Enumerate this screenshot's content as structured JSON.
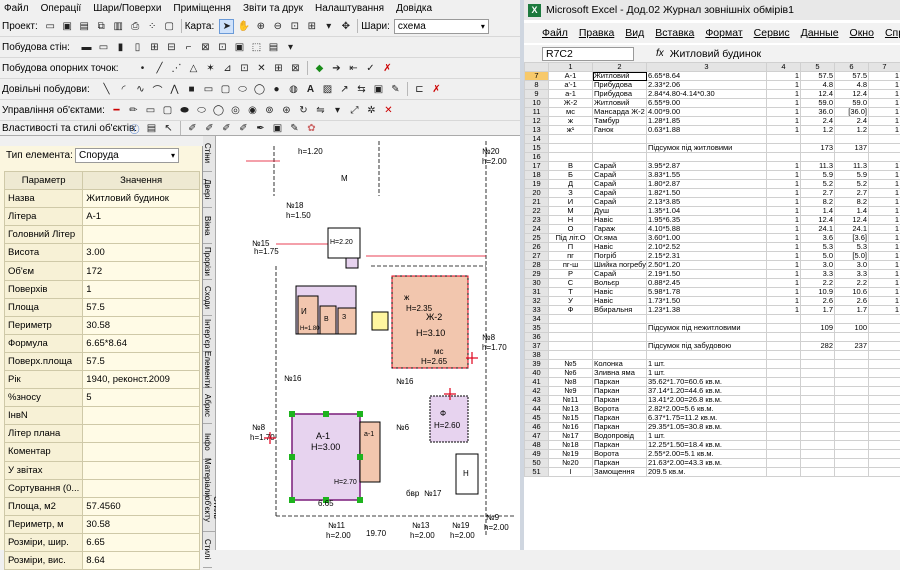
{
  "menu": [
    "Файл",
    "Операції",
    "Шари/Поверхи",
    "Приміщення",
    "Звіти та друк",
    "Налаштування",
    "Довідка"
  ],
  "toolbar": {
    "project_label": "Проект:",
    "map_label": "Карта:",
    "layers_label": "Шари:",
    "layers_value": "схема",
    "walls_label": "Побудова стін:",
    "points_label": "Побудова опорних точок:",
    "arbitrary_label": "Довільні побудови:",
    "objects_label": "Управління об'єктами:",
    "styles_label": "Властивості та стилі об'єктів:"
  },
  "properties": {
    "type_label": "Тип елемента:",
    "type_value": "Споруда",
    "col_param": "Параметр",
    "col_value": "Значення",
    "rows": [
      {
        "k": "Назва",
        "v": "Житловий будинок"
      },
      {
        "k": "Літера",
        "v": "А-1"
      },
      {
        "k": "Головний Літер",
        "v": ""
      },
      {
        "k": "Висота",
        "v": "3.00"
      },
      {
        "k": "Об'єм",
        "v": "172"
      },
      {
        "k": "Поверхів",
        "v": "1"
      },
      {
        "k": "Площа",
        "v": "57.5"
      },
      {
        "k": "Периметр",
        "v": "30.58"
      },
      {
        "k": "Формула",
        "v": "6.65*8.64"
      },
      {
        "k": "Поверх.площа",
        "v": "57.5"
      },
      {
        "k": "Рік",
        "v": "1940, реконст.2009"
      },
      {
        "k": "%зносу",
        "v": "5"
      },
      {
        "k": "ІнвN",
        "v": ""
      },
      {
        "k": "Літер плана",
        "v": ""
      },
      {
        "k": "Коментар",
        "v": ""
      },
      {
        "k": "У звітах",
        "v": ""
      },
      {
        "k": "Сортування (0...",
        "v": ""
      },
      {
        "k": "Площа, м2",
        "v": "57.4560"
      },
      {
        "k": "Периметр, м",
        "v": "30.58"
      },
      {
        "k": "Розміри, шир.",
        "v": "6.65"
      },
      {
        "k": "Розміри, вис.",
        "v": "8.64"
      }
    ]
  },
  "side_tabs": [
    "Стіни",
    "Двері",
    "Вікна",
    "Прорізи",
    "Сходи",
    "Інтер'єр",
    "Елементи",
    "Абрис",
    "Інфо",
    "Матеріали",
    "Стиль об'єкту",
    "Стилі"
  ],
  "plan": {
    "labels": [
      "A-1",
      "H=3.00",
      "Ж",
      "Ж-2",
      "мс",
      "З",
      "И",
      "В",
      "№15",
      "№18",
      "№20",
      "№16",
      "№16",
      "№8",
      "№9",
      "№8",
      "№6",
      "№11",
      "№13",
      "№19",
      "№17",
      "Ф",
      "Н",
      "пг-ш",
      "пг",
      "Б",
      "С",
      "а-1",
      "h=1.70",
      "h=1.75",
      "h=1.50",
      "h=2.00",
      "h=1.70",
      "h=2.00",
      "h=2.00",
      "h=2.00",
      "H=2.60",
      "H=3.10",
      "H=2.35",
      "H=2.65",
      "H=2.20",
      "H=1.80",
      "H=2.70",
      "6.65",
      "8.64",
      "19.70",
      "12.40",
      "9.75",
      "4.10",
      "бвр"
    ]
  },
  "excel": {
    "title": "Microsoft Excel - Дод.02 Журнал зовнішніх обмірів1",
    "menu": [
      "Файл",
      "Правка",
      "Вид",
      "Вставка",
      "Формат",
      "Сервис",
      "Данные",
      "Окно",
      "Спр"
    ],
    "namebox": "R7C2",
    "formula": "Житловий будинок",
    "col_headers": [
      "",
      "1",
      "2",
      "3",
      "4",
      "5",
      "6",
      "7"
    ],
    "rows": [
      [
        "7",
        "А-1",
        "Житловий",
        "6.65*8.64",
        "1",
        "57.5",
        "57.5",
        "1"
      ],
      [
        "8",
        "а'-1",
        "Прибудова",
        "2.33*2.06",
        "1",
        "4.8",
        "4.8",
        "1"
      ],
      [
        "9",
        "а-1",
        "Прибудова",
        "2.84*4.80-4.14*0.30",
        "1",
        "12.4",
        "12.4",
        "1"
      ],
      [
        "10",
        "Ж-2",
        "Житловий",
        "6.55*9.00",
        "1",
        "59.0",
        "59.0",
        "1"
      ],
      [
        "11",
        "мс",
        "Мансарда Ж-2",
        "4.00*9.00",
        "1",
        "36.0",
        "[36.0]",
        "1"
      ],
      [
        "12",
        "ж",
        "Тамбур",
        "1.28*1.85",
        "1",
        "2.4",
        "2.4",
        "1"
      ],
      [
        "13",
        "ж¹",
        "Ганок",
        "0.63*1.88",
        "1",
        "1.2",
        "1.2",
        "1"
      ],
      [
        "14",
        "",
        "",
        "",
        "",
        "",
        "",
        ""
      ],
      [
        "15",
        "",
        "",
        "Підсумок під житловими",
        "",
        "173",
        "137",
        ""
      ],
      [
        "16",
        "",
        "",
        "",
        "",
        "",
        "",
        ""
      ],
      [
        "17",
        "В",
        "Сарай",
        "3.95*2.87",
        "1",
        "11.3",
        "11.3",
        "1"
      ],
      [
        "18",
        "Б",
        "Сарай",
        "3.83*1.55",
        "1",
        "5.9",
        "5.9",
        "1"
      ],
      [
        "19",
        "Д",
        "Сарай",
        "1.80*2.87",
        "1",
        "5.2",
        "5.2",
        "1"
      ],
      [
        "20",
        "З",
        "Сарай",
        "1.82*1.50",
        "1",
        "2.7",
        "2.7",
        "1"
      ],
      [
        "21",
        "И",
        "Сарай",
        "2.13*3.85",
        "1",
        "8.2",
        "8.2",
        "1"
      ],
      [
        "22",
        "М",
        "Душ",
        "1.35*1.04",
        "1",
        "1.4",
        "1.4",
        "1"
      ],
      [
        "23",
        "Н",
        "Навіс",
        "1.95*6.35",
        "1",
        "12.4",
        "12.4",
        "1"
      ],
      [
        "24",
        "О",
        "Гараж",
        "4.10*5.88",
        "1",
        "24.1",
        "24.1",
        "1"
      ],
      [
        "25",
        "Під літ.О",
        "Ог.яма",
        "3.60*1.00",
        "1",
        "3.6",
        "[3.6]",
        "1"
      ],
      [
        "26",
        "П",
        "Навіс",
        "2.10*2.52",
        "1",
        "5.3",
        "5.3",
        "1"
      ],
      [
        "27",
        "пг",
        "Погріб",
        "2.15*2.31",
        "1",
        "5.0",
        "[5.0]",
        "1"
      ],
      [
        "28",
        "пг-ш",
        "Шийка погребу",
        "2.50*1.20",
        "1",
        "3.0",
        "3.0",
        "1"
      ],
      [
        "29",
        "Р",
        "Сарай",
        "2.19*1.50",
        "1",
        "3.3",
        "3.3",
        "1"
      ],
      [
        "30",
        "С",
        "Вольєр",
        "0.88*2.45",
        "1",
        "2.2",
        "2.2",
        "1"
      ],
      [
        "31",
        "Т",
        "Навіс",
        "5.98*1.78",
        "1",
        "10.9",
        "10.6",
        "1"
      ],
      [
        "32",
        "У",
        "Навіс",
        "1.73*1.50",
        "1",
        "2.6",
        "2.6",
        "1"
      ],
      [
        "33",
        "Ф",
        "Вбиральня",
        "1.23*1.38",
        "1",
        "1.7",
        "1.7",
        "1"
      ],
      [
        "34",
        "",
        "",
        "",
        "",
        "",
        "",
        ""
      ],
      [
        "35",
        "",
        "",
        "Підсумок під нежитловими",
        "",
        "109",
        "100",
        ""
      ],
      [
        "36",
        "",
        "",
        "",
        "",
        "",
        "",
        ""
      ],
      [
        "37",
        "",
        "",
        "Підсумок під забудовою",
        "",
        "282",
        "237",
        ""
      ],
      [
        "38",
        "",
        "",
        "",
        "",
        "",
        "",
        ""
      ],
      [
        "39",
        "№5",
        "Колонка",
        "1 шт.",
        "",
        "",
        "",
        ""
      ],
      [
        "40",
        "№6",
        "Зливна яма",
        "1 шт.",
        "",
        "",
        "",
        ""
      ],
      [
        "41",
        "№8",
        "Паркан",
        "35.62*1.70=60.6 кв.м.",
        "",
        "",
        "",
        ""
      ],
      [
        "42",
        "№9",
        "Паркан",
        "37.14*1.20=44.6 кв.м.",
        "",
        "",
        "",
        ""
      ],
      [
        "43",
        "№11",
        "Паркан",
        "13.41*2.00=26.8 кв.м.",
        "",
        "",
        "",
        ""
      ],
      [
        "44",
        "№13",
        "Ворота",
        "2.82*2.00=5.6 кв.м.",
        "",
        "",
        "",
        ""
      ],
      [
        "45",
        "№15",
        "Паркан",
        "6.37*1.75=11.2 кв.м.",
        "",
        "",
        "",
        ""
      ],
      [
        "46",
        "№16",
        "Паркан",
        "29.35*1.05=30.8 кв.м.",
        "",
        "",
        "",
        ""
      ],
      [
        "47",
        "№17",
        "Водопровід",
        "1 шт.",
        "",
        "",
        "",
        ""
      ],
      [
        "48",
        "№18",
        "Паркан",
        "12.25*1.50=18.4 кв.м.",
        "",
        "",
        "",
        ""
      ],
      [
        "49",
        "№19",
        "Ворота",
        "2.55*2.00=5.1 кв.м.",
        "",
        "",
        "",
        ""
      ],
      [
        "50",
        "№20",
        "Паркан",
        "21.63*2.00=43.3 кв.м.",
        "",
        "",
        "",
        ""
      ],
      [
        "51",
        "І",
        "Замощення",
        "209.5 кв.м.",
        "",
        "",
        "",
        ""
      ]
    ]
  },
  "colors": {
    "selected_row": "#f7c96b",
    "house_fill": "#e7d3ef",
    "annex_fill": "#f2c6ae",
    "red": "#e0001c"
  }
}
